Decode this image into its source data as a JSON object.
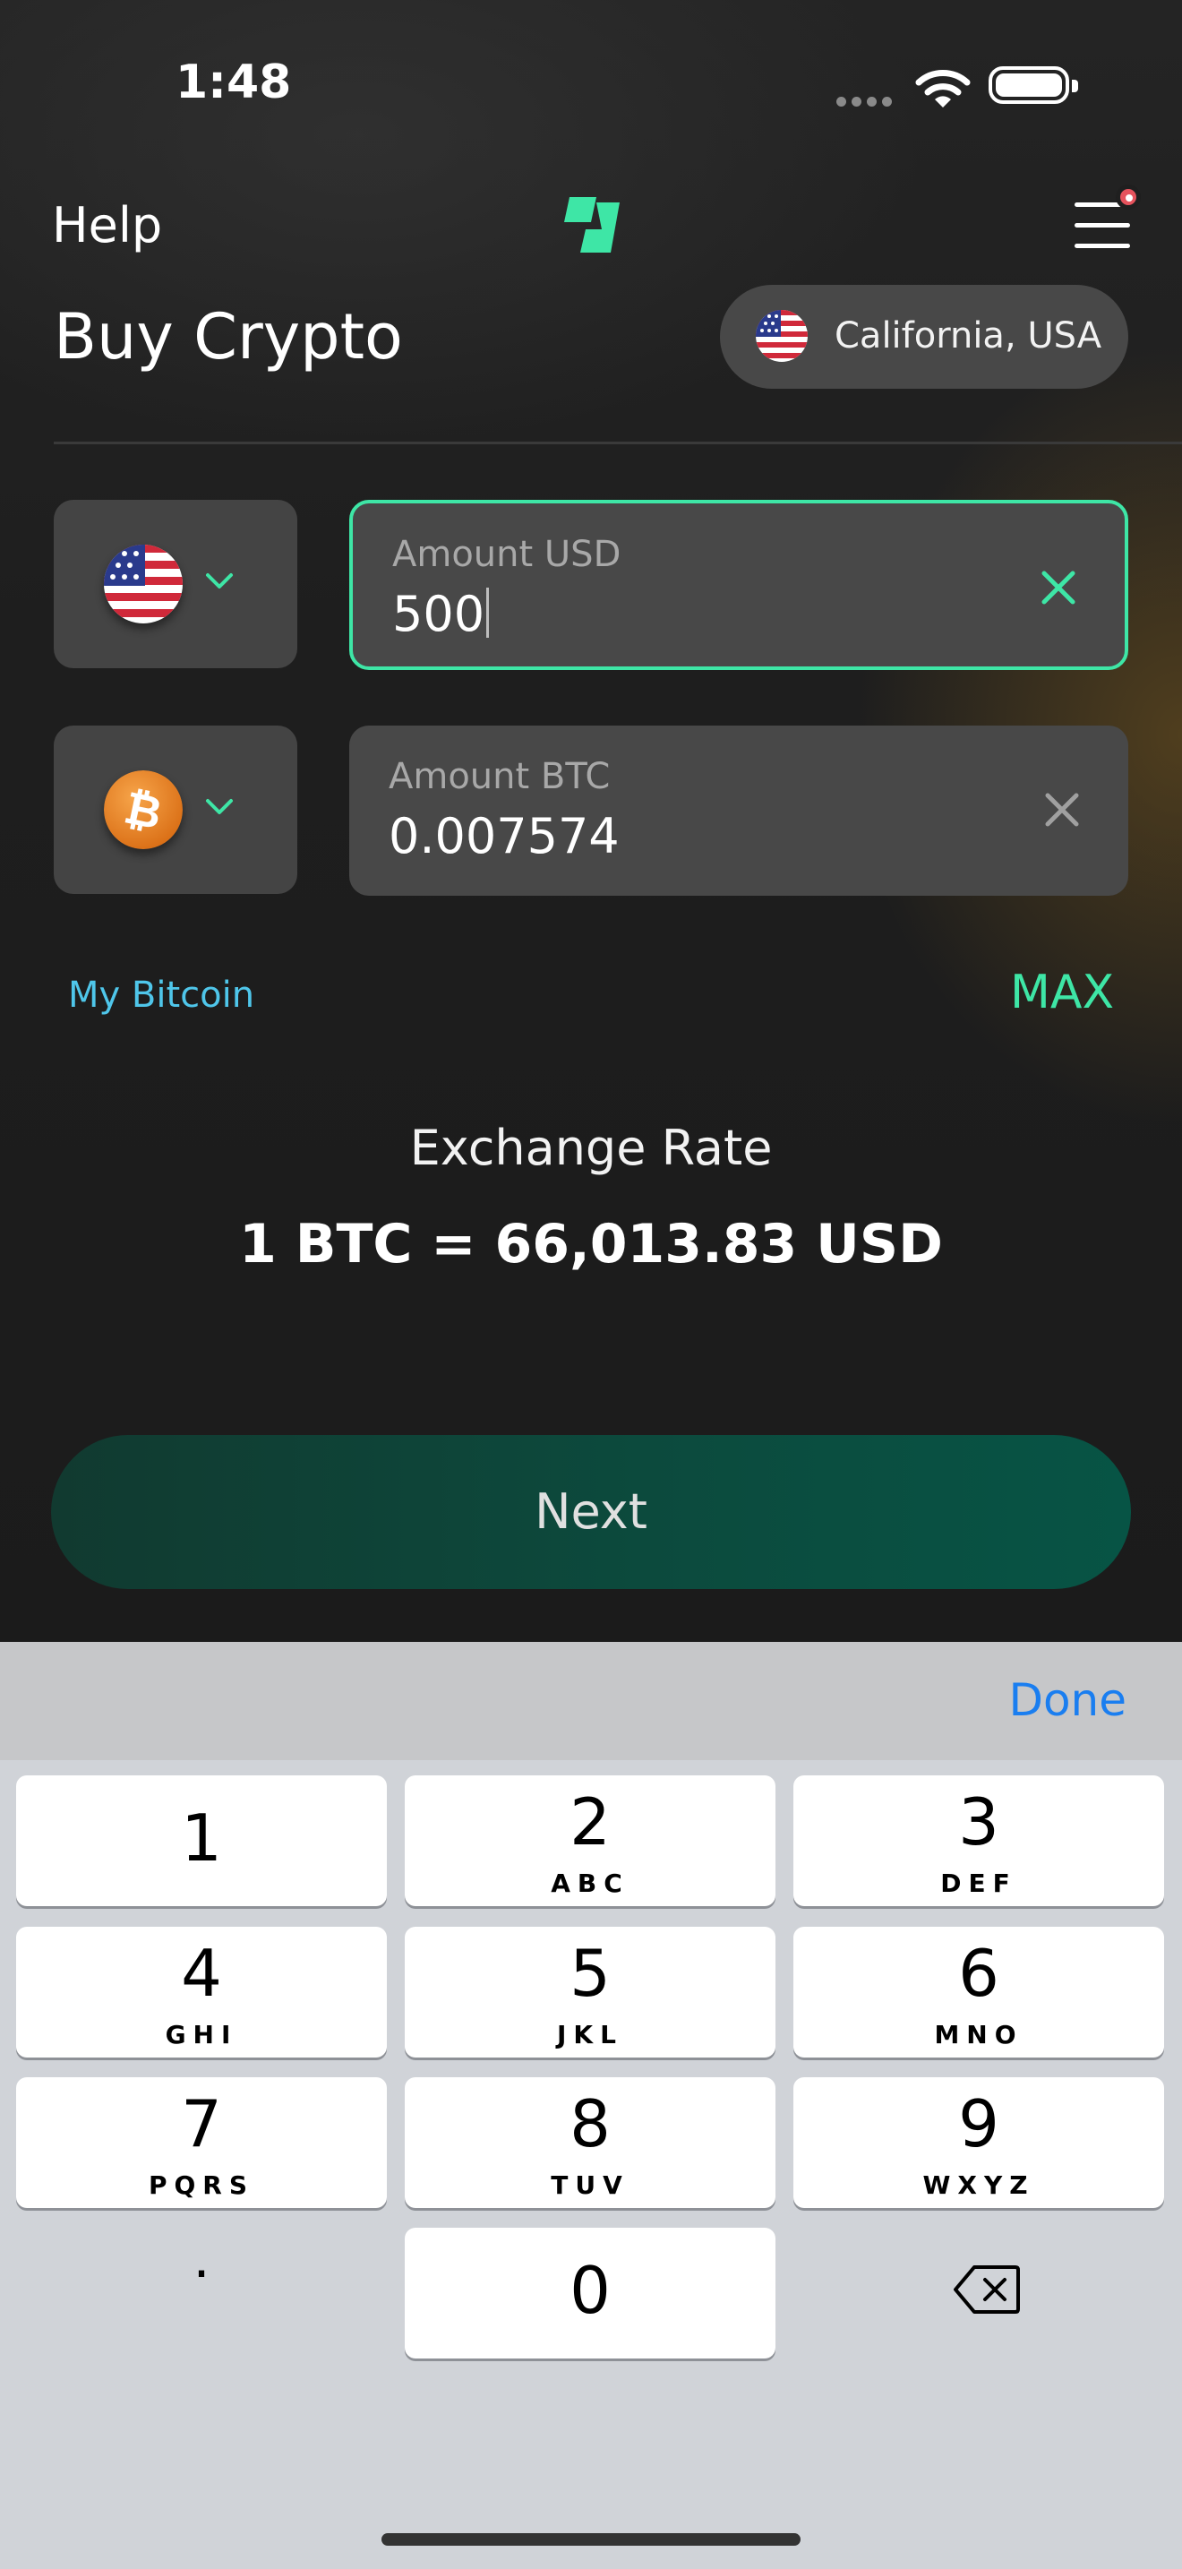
{
  "status_bar": {
    "time": "1:48"
  },
  "header": {
    "help_label": "Help",
    "logo_icon": "brand-logo-icon",
    "menu_icon": "hamburger-menu-icon"
  },
  "page": {
    "title": "Buy Crypto",
    "location": "California, USA"
  },
  "fiat_row": {
    "currency_icon": "us-flag-icon",
    "label": "Amount USD",
    "value": "500"
  },
  "crypto_row": {
    "currency_icon": "bitcoin-icon",
    "label": "Amount BTC",
    "value": "0.007574"
  },
  "links": {
    "my_bitcoin": "My Bitcoin",
    "max": "MAX"
  },
  "exchange": {
    "label": "Exchange Rate",
    "value": "1 BTC = 66,013.83 USD"
  },
  "next_button": "Next",
  "keyboard": {
    "done": "Done",
    "keys": [
      {
        "digit": "1",
        "letters": ""
      },
      {
        "digit": "2",
        "letters": "ABC"
      },
      {
        "digit": "3",
        "letters": "DEF"
      },
      {
        "digit": "4",
        "letters": "GHI"
      },
      {
        "digit": "5",
        "letters": "JKL"
      },
      {
        "digit": "6",
        "letters": "MNO"
      },
      {
        "digit": "7",
        "letters": "PQRS"
      },
      {
        "digit": "8",
        "letters": "TUV"
      },
      {
        "digit": "9",
        "letters": "WXYZ"
      },
      {
        "digit": "0",
        "letters": ""
      }
    ],
    "decimal": "."
  },
  "colors": {
    "accent": "#3ee6a6",
    "link": "#4fc6ea",
    "done": "#1a7ef0"
  }
}
